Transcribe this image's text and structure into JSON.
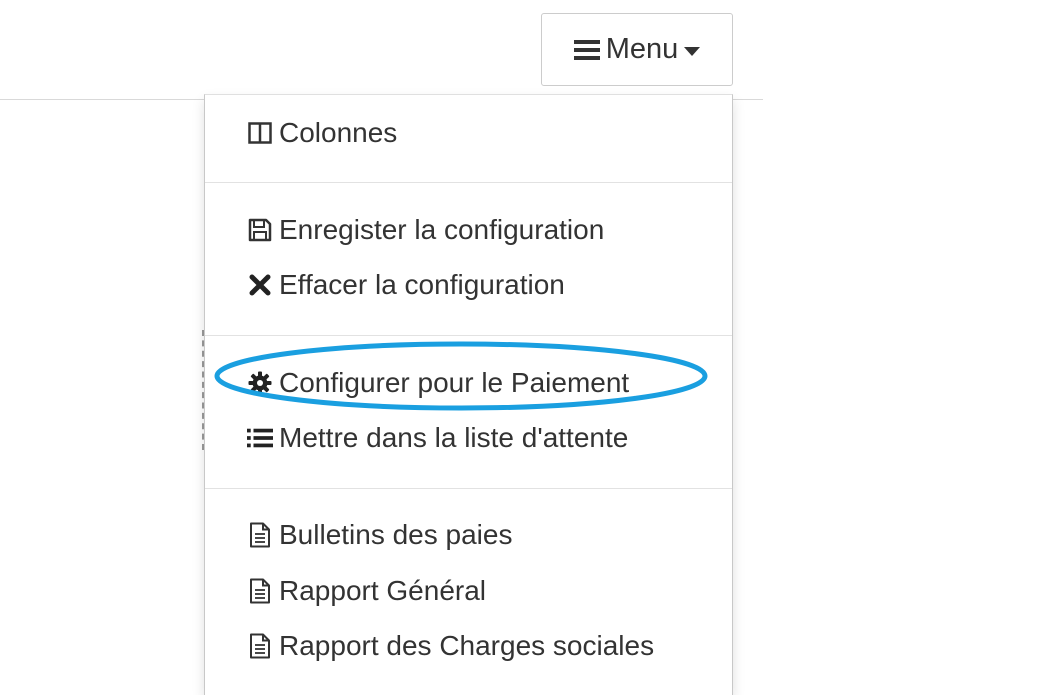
{
  "menu_button": {
    "label": "Menu",
    "icon": "bars-icon",
    "caret": "caret-down-icon"
  },
  "dropdown": {
    "sections": [
      {
        "items": [
          {
            "label": "Colonnes",
            "icon": "columns-icon"
          }
        ]
      },
      {
        "items": [
          {
            "label": "Enregister la configuration",
            "icon": "floppy-disk-icon"
          },
          {
            "label": "Effacer la configuration",
            "icon": "close-icon"
          }
        ]
      },
      {
        "items": [
          {
            "label": "Configurer pour le Paiement",
            "icon": "gear-icon",
            "highlighted": true
          },
          {
            "label": "Mettre dans la liste d'attente",
            "icon": "list-icon"
          }
        ]
      },
      {
        "items": [
          {
            "label": "Bulletins des paies",
            "icon": "document-icon"
          },
          {
            "label": "Rapport Général",
            "icon": "document-icon"
          },
          {
            "label": "Rapport des Charges sociales",
            "icon": "document-icon"
          }
        ]
      }
    ]
  },
  "annotation": {
    "highlight_color": "#1a9fe0"
  }
}
